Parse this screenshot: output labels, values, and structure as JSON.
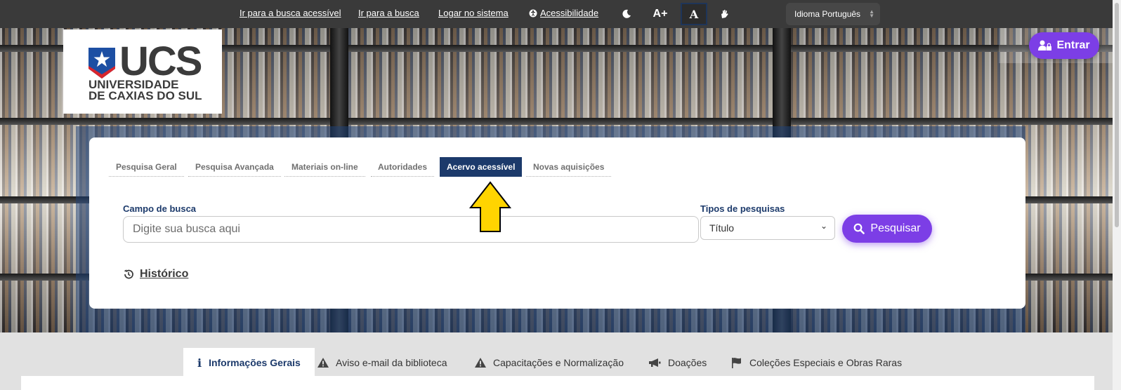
{
  "topbar": {
    "links": [
      "Ir para a busca acessível",
      "Ir para a busca",
      "Logar no sistema"
    ],
    "accessibility_label": "Acessibilidade",
    "font_increase_label": "A+",
    "contrast_label": "A",
    "language_select": "Idioma Português"
  },
  "header": {
    "logo_text": "UCS",
    "logo_subtext_1": "UNIVERSIDADE",
    "logo_subtext_2": "DE CAXIAS DO SUL",
    "login_button": "Entrar"
  },
  "search": {
    "tabs": [
      {
        "label": "Pesquisa Geral",
        "active": false
      },
      {
        "label": "Pesquisa Avançada",
        "active": false
      },
      {
        "label": "Materiais on-line",
        "active": false
      },
      {
        "label": "Autoridades",
        "active": false
      },
      {
        "label": "Acervo acessível",
        "active": true
      },
      {
        "label": "Novas aquisições",
        "active": false
      }
    ],
    "field_label": "Campo de busca",
    "placeholder": "Digite sua busca aqui",
    "type_label": "Tipos de pesquisas",
    "type_selected": "Título",
    "submit_label": "Pesquisar",
    "history_label": "Histórico"
  },
  "info_tabs": [
    {
      "label": "Informações Gerais",
      "icon": "info-icon",
      "active": true
    },
    {
      "label": "Aviso e-mail da biblioteca",
      "icon": "warning-icon",
      "active": false
    },
    {
      "label": "Capacitações e Normalização",
      "icon": "warning-icon",
      "active": false
    },
    {
      "label": "Doações",
      "icon": "megaphone-icon",
      "active": false
    },
    {
      "label": "Coleções Especiais e Obras Raras",
      "icon": "flag-icon",
      "active": false
    }
  ],
  "colors": {
    "primary_purple": "#7c3ee6",
    "navy": "#1c3a6b",
    "topbar": "#3a3a3a",
    "arrow_yellow": "#ffd400"
  }
}
